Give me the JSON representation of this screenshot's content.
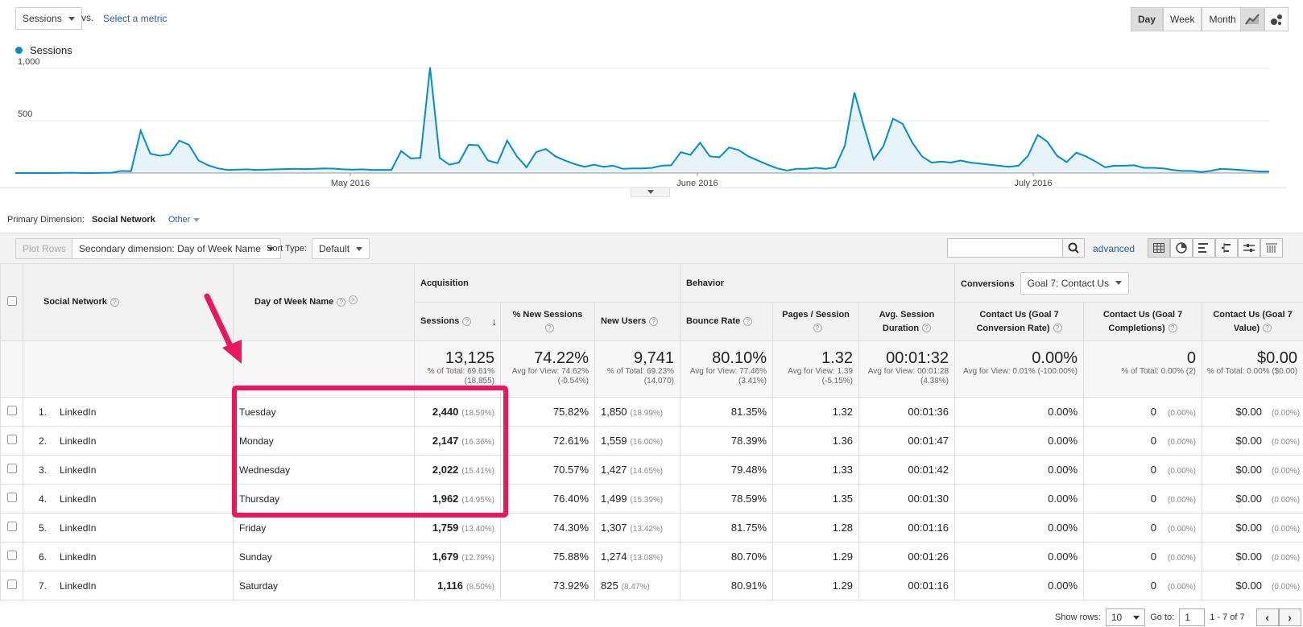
{
  "header": {
    "metric_label": "Sessions",
    "vs_label": "vs.",
    "select_metric": "Select a metric",
    "period_buttons": [
      "Day",
      "Week",
      "Month"
    ],
    "active_period": "Day"
  },
  "legend": {
    "label": "Sessions",
    "color": "#058dc7"
  },
  "chart_data": {
    "type": "area",
    "series": [
      {
        "name": "Sessions",
        "values": [
          0,
          0,
          0,
          0,
          0,
          2,
          3,
          0,
          0,
          2,
          3,
          20,
          18,
          405,
          185,
          165,
          180,
          310,
          270,
          120,
          75,
          45,
          30,
          32,
          35,
          30,
          32,
          35,
          38,
          40,
          38,
          40,
          45,
          42,
          35,
          32,
          35,
          30,
          30,
          30,
          210,
          140,
          145,
          1010,
          145,
          80,
          100,
          270,
          265,
          120,
          95,
          310,
          160,
          55,
          200,
          230,
          160,
          120,
          85,
          60,
          80,
          60,
          70,
          40,
          45,
          45,
          50,
          70,
          75,
          200,
          175,
          290,
          160,
          150,
          245,
          220,
          160,
          120,
          80,
          45,
          25,
          40,
          40,
          50,
          40,
          55,
          260,
          770,
          440,
          130,
          255,
          520,
          470,
          290,
          160,
          100,
          110,
          100,
          120,
          100,
          90,
          80,
          70,
          60,
          70,
          165,
          365,
          300,
          165,
          105,
          195,
          160,
          110,
          55,
          70,
          70,
          75,
          50,
          50,
          45,
          30,
          20,
          20,
          10,
          22,
          40,
          35,
          30,
          22,
          15,
          15
        ],
        "color": "#058dc7"
      }
    ],
    "y_ticks": [
      "1,000",
      "500"
    ],
    "x_ticks": [
      "May 2016",
      "June 2016",
      "July 2016"
    ],
    "ylim": [
      0,
      1000
    ]
  },
  "dimension_bar": {
    "label": "Primary Dimension:",
    "current": "Social Network",
    "other": "Other"
  },
  "toolbar": {
    "plot_rows": "Plot Rows",
    "secondary_dimension": "Secondary dimension: Day of Week Name",
    "sort_label": "Sort Type:",
    "sort_value": "Default",
    "advanced": "advanced"
  },
  "table": {
    "group_headers": {
      "acquisition": "Acquisition",
      "behavior": "Behavior",
      "conversions": "Conversions",
      "goal_select": "Goal 7: Contact Us"
    },
    "columns": {
      "social_network": "Social Network",
      "day_of_week": "Day of Week Name",
      "sessions": "Sessions",
      "new_sessions": "% New Sessions",
      "new_users": "New Users",
      "bounce_rate": "Bounce Rate",
      "pages_session": "Pages / Session",
      "avg_duration": "Avg. Session Duration",
      "conv_rate": "Contact Us (Goal 7 Conversion Rate)",
      "completions": "Contact Us (Goal 7 Completions)",
      "value": "Contact Us (Goal 7 Value)"
    },
    "totals": {
      "sessions": {
        "big": "13,125",
        "small": "% of Total: 69.61% (18,855)"
      },
      "new_sessions": {
        "big": "74.22%",
        "small": "Avg for View: 74.62% (-0.54%)"
      },
      "new_users": {
        "big": "9,741",
        "small": "% of Total: 69.23% (14,070)"
      },
      "bounce_rate": {
        "big": "80.10%",
        "small": "Avg for View: 77.46% (3.41%)"
      },
      "pages_session": {
        "big": "1.32",
        "small": "Avg for View: 1.39 (-5.15%)"
      },
      "avg_duration": {
        "big": "00:01:32",
        "small": "Avg for View: 00:01:28 (4.38%)"
      },
      "conv_rate": {
        "big": "0.00%",
        "small": "Avg for View: 0.01% (-100.00%)"
      },
      "completions": {
        "big": "0",
        "small": "% of Total: 0.00% (2)"
      },
      "value": {
        "big": "$0.00",
        "small": "% of Total: 0.00% ($0.00)"
      }
    },
    "rows": [
      {
        "idx": "1.",
        "network": "LinkedIn",
        "day": "Tuesday",
        "sessions": "2,440",
        "sessions_pct": "(18.59%)",
        "new_sessions": "75.82%",
        "new_users": "1,850",
        "new_users_pct": "(18.99%)",
        "bounce": "81.35%",
        "pages": "1.32",
        "duration": "00:01:36",
        "conv_rate": "0.00%",
        "completions": "0",
        "completions_pct": "(0.00%)",
        "value": "$0.00",
        "value_pct": "(0.00%)"
      },
      {
        "idx": "2.",
        "network": "LinkedIn",
        "day": "Monday",
        "sessions": "2,147",
        "sessions_pct": "(16.36%)",
        "new_sessions": "72.61%",
        "new_users": "1,559",
        "new_users_pct": "(16.00%)",
        "bounce": "78.39%",
        "pages": "1.36",
        "duration": "00:01:47",
        "conv_rate": "0.00%",
        "completions": "0",
        "completions_pct": "(0.00%)",
        "value": "$0.00",
        "value_pct": "(0.00%)"
      },
      {
        "idx": "3.",
        "network": "LinkedIn",
        "day": "Wednesday",
        "sessions": "2,022",
        "sessions_pct": "(15.41%)",
        "new_sessions": "70.57%",
        "new_users": "1,427",
        "new_users_pct": "(14.65%)",
        "bounce": "79.48%",
        "pages": "1.33",
        "duration": "00:01:42",
        "conv_rate": "0.00%",
        "completions": "0",
        "completions_pct": "(0.00%)",
        "value": "$0.00",
        "value_pct": "(0.00%)"
      },
      {
        "idx": "4.",
        "network": "LinkedIn",
        "day": "Thursday",
        "sessions": "1,962",
        "sessions_pct": "(14.95%)",
        "new_sessions": "76.40%",
        "new_users": "1,499",
        "new_users_pct": "(15.39%)",
        "bounce": "78.59%",
        "pages": "1.35",
        "duration": "00:01:30",
        "conv_rate": "0.00%",
        "completions": "0",
        "completions_pct": "(0.00%)",
        "value": "$0.00",
        "value_pct": "(0.00%)"
      },
      {
        "idx": "5.",
        "network": "LinkedIn",
        "day": "Friday",
        "sessions": "1,759",
        "sessions_pct": "(13.40%)",
        "new_sessions": "74.30%",
        "new_users": "1,307",
        "new_users_pct": "(13.42%)",
        "bounce": "81.75%",
        "pages": "1.28",
        "duration": "00:01:16",
        "conv_rate": "0.00%",
        "completions": "0",
        "completions_pct": "(0.00%)",
        "value": "$0.00",
        "value_pct": "(0.00%)"
      },
      {
        "idx": "6.",
        "network": "LinkedIn",
        "day": "Sunday",
        "sessions": "1,679",
        "sessions_pct": "(12.79%)",
        "new_sessions": "75.88%",
        "new_users": "1,274",
        "new_users_pct": "(13.08%)",
        "bounce": "80.70%",
        "pages": "1.29",
        "duration": "00:01:26",
        "conv_rate": "0.00%",
        "completions": "0",
        "completions_pct": "(0.00%)",
        "value": "$0.00",
        "value_pct": "(0.00%)"
      },
      {
        "idx": "7.",
        "network": "LinkedIn",
        "day": "Saturday",
        "sessions": "1,116",
        "sessions_pct": "(8.50%)",
        "new_sessions": "73.92%",
        "new_users": "825",
        "new_users_pct": "(8.47%)",
        "bounce": "80.91%",
        "pages": "1.29",
        "duration": "00:01:16",
        "conv_rate": "0.00%",
        "completions": "0",
        "completions_pct": "(0.00%)",
        "value": "$0.00",
        "value_pct": "(0.00%)"
      }
    ]
  },
  "pager": {
    "show_rows_label": "Show rows:",
    "show_rows_value": "10",
    "goto_label": "Go to:",
    "goto_value": "1",
    "range": "1 - 7 of 7"
  },
  "annotation": {
    "highlight_color": "#e8185b"
  }
}
